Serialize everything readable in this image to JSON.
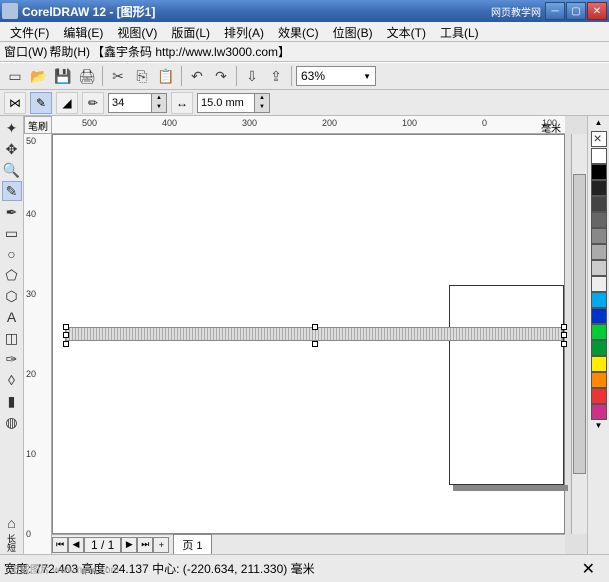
{
  "title": "CorelDRAW 12 - [图形1]",
  "logo": "网页教学网",
  "menu": {
    "file": "文件(F)",
    "edit": "编辑(E)",
    "view": "视图(V)",
    "layout": "版面(L)",
    "arrange": "排列(A)",
    "effects": "效果(C)",
    "bitmap": "位图(B)",
    "text": "文本(T)",
    "tools": "工具(L)",
    "window": "窗口(W)",
    "help": "帮助(H)",
    "barcode": "【鑫宇条码 http://www.lw3000.com】"
  },
  "toolbar": {
    "zoom": "63%"
  },
  "propbar": {
    "stroke_width": "34",
    "dimension_icon": "↔",
    "dimension": "15.0 mm"
  },
  "ruler": {
    "corner": "笔刷",
    "h": [
      "500",
      "400",
      "300",
      "200",
      "100",
      "0",
      "100"
    ],
    "unit": "毫米",
    "v": [
      "50",
      "40",
      "30",
      "20",
      "10",
      "0"
    ],
    "v_label": "长短"
  },
  "pages": {
    "current": "1 / 1",
    "tab": "页 1"
  },
  "status": {
    "watermark": "下载图片 www.nipic.com",
    "text": "宽度: 772.403  高度: 24.137  中心: (-220.634, 211.330) 毫米",
    "close": "✕"
  },
  "colors": [
    "#ffffff",
    "#000000",
    "#222222",
    "#444444",
    "#666666",
    "#888888",
    "#aaaaaa",
    "#cccccc",
    "#eeeeee",
    "#00aaee",
    "#0033cc",
    "#00cc33",
    "#009933",
    "#ffee00",
    "#ff8800",
    "#ee3333",
    "#cc3388"
  ]
}
